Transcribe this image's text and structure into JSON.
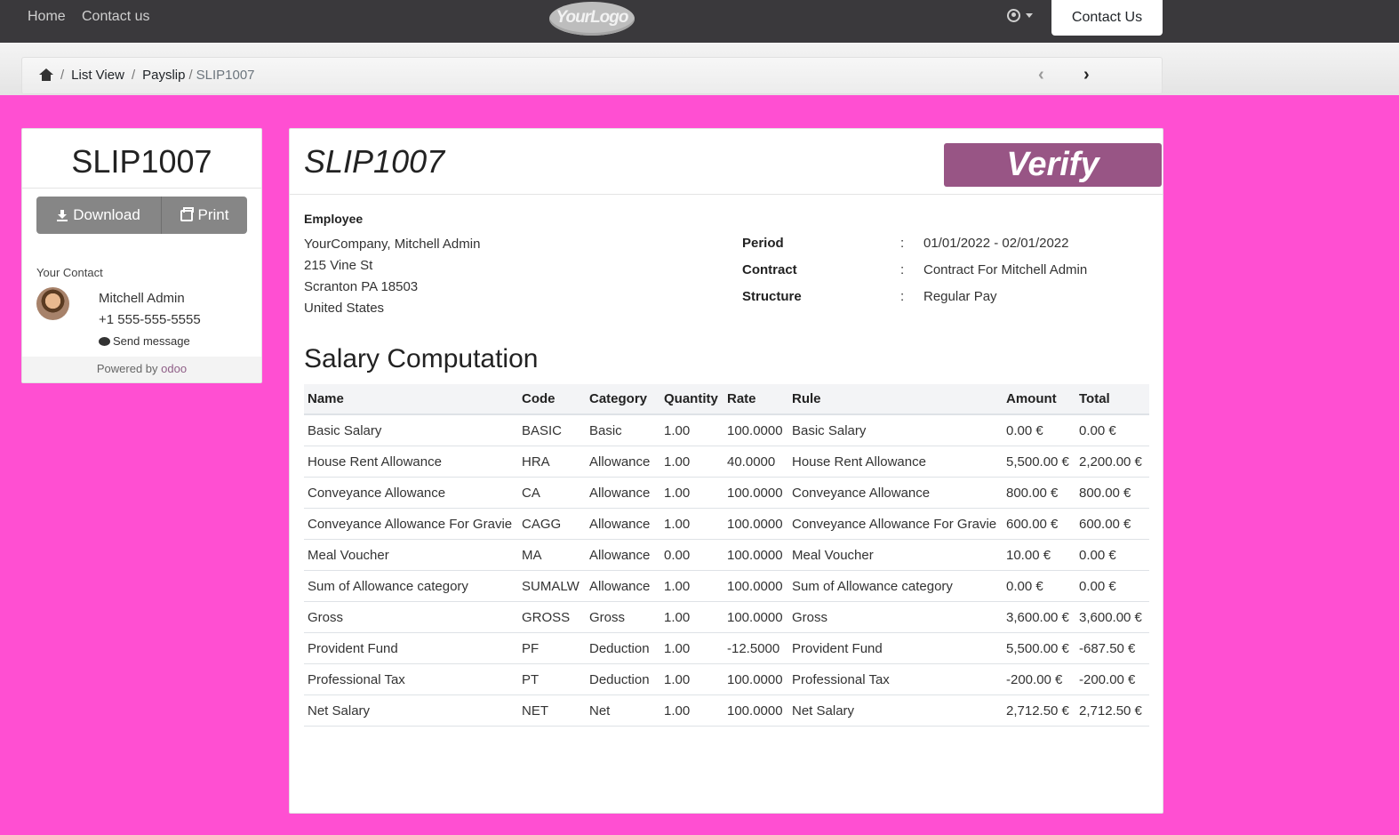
{
  "navbar": {
    "links": [
      "Home",
      "Contact us"
    ],
    "logo_text": "YourLogo",
    "contact_button": "Contact Us"
  },
  "breadcrumb": {
    "items": [
      "List View",
      "Payslip"
    ],
    "separator": "/",
    "active": "SLIP1007"
  },
  "pager": {
    "prev": "‹",
    "next": "›"
  },
  "sidebar": {
    "title": "SLIP1007",
    "download_label": "Download",
    "print_label": "Print",
    "your_contact_label": "Your Contact",
    "contact_name": "Mitchell Admin",
    "contact_phone": "+1 555-555-5555",
    "send_message_label": "Send message",
    "powered_by": "Powered by",
    "powered_brand": "odoo"
  },
  "main": {
    "title": "SLIP1007",
    "verify_label": "Verify",
    "employee_label": "Employee",
    "address": [
      "YourCompany, Mitchell Admin",
      "215 Vine St",
      "Scranton PA 18503",
      "United States"
    ],
    "info": [
      {
        "label": "Period",
        "value": "01/01/2022 - 02/01/2022"
      },
      {
        "label": "Contract",
        "value": "Contract For Mitchell Admin"
      },
      {
        "label": "Structure",
        "value": "Regular Pay"
      }
    ],
    "section_title": "Salary Computation",
    "table": {
      "headers": [
        "Name",
        "Code",
        "Category",
        "Quantity",
        "Rate",
        "Rule",
        "Amount",
        "Total"
      ],
      "rows": [
        [
          "Basic Salary",
          "BASIC",
          "Basic",
          "1.00",
          "100.0000",
          "Basic Salary",
          "0.00 €",
          "0.00 €"
        ],
        [
          "House Rent Allowance",
          "HRA",
          "Allowance",
          "1.00",
          "40.0000",
          "House Rent Allowance",
          "5,500.00 €",
          "2,200.00 €"
        ],
        [
          "Conveyance Allowance",
          "CA",
          "Allowance",
          "1.00",
          "100.0000",
          "Conveyance Allowance",
          "800.00 €",
          "800.00 €"
        ],
        [
          "Conveyance Allowance For Gravie",
          "CAGG",
          "Allowance",
          "1.00",
          "100.0000",
          "Conveyance Allowance For Gravie",
          "600.00 €",
          "600.00 €"
        ],
        [
          "Meal Voucher",
          "MA",
          "Allowance",
          "0.00",
          "100.0000",
          "Meal Voucher",
          "10.00 €",
          "0.00 €"
        ],
        [
          "Sum of Allowance category",
          "SUMALW",
          "Allowance",
          "1.00",
          "100.0000",
          "Sum of Allowance category",
          "0.00 €",
          "0.00 €"
        ],
        [
          "Gross",
          "GROSS",
          "Gross",
          "1.00",
          "100.0000",
          "Gross",
          "3,600.00 €",
          "3,600.00 €"
        ],
        [
          "Provident Fund",
          "PF",
          "Deduction",
          "1.00",
          "-12.5000",
          "Provident Fund",
          "5,500.00 €",
          "-687.50 €"
        ],
        [
          "Professional Tax",
          "PT",
          "Deduction",
          "1.00",
          "100.0000",
          "Professional Tax",
          "-200.00 €",
          "-200.00 €"
        ],
        [
          "Net Salary",
          "NET",
          "Net",
          "1.00",
          "100.0000",
          "Net Salary",
          "2,712.50 €",
          "2,712.50 €"
        ]
      ]
    }
  },
  "colors": {
    "page_background": "#ff4fd2",
    "navbar": "#3a393c",
    "verify_button": "#985585",
    "gray_button": "#868686"
  }
}
